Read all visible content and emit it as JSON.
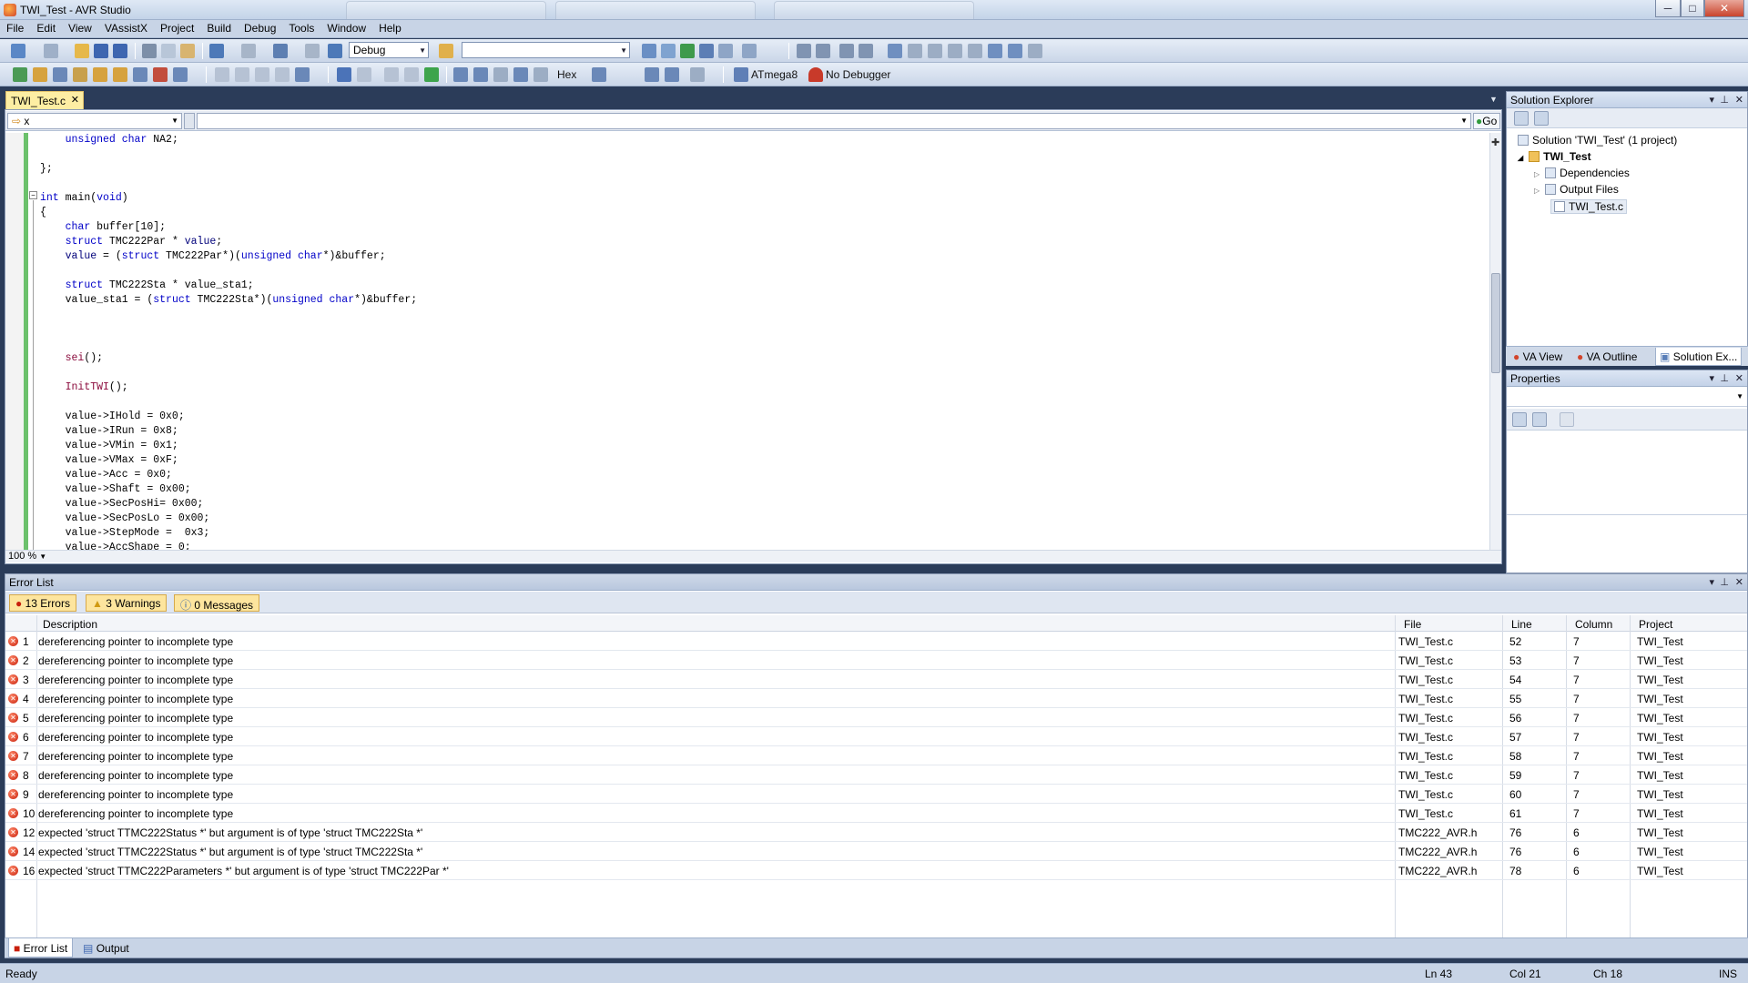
{
  "window": {
    "title": "TWI_Test - AVR Studio",
    "controls": [
      "─",
      "□",
      "✕"
    ]
  },
  "menu": [
    "File",
    "Edit",
    "View",
    "VAssistX",
    "Project",
    "Build",
    "Debug",
    "Tools",
    "Window",
    "Help"
  ],
  "toolbar": {
    "config_combo": "Debug",
    "search_combo": "",
    "hex_label": "Hex",
    "device": "ATmega8",
    "debugger": "No Debugger"
  },
  "editor": {
    "tab_label": "TWI_Test.c",
    "nav_left": "x",
    "go_label": "Go",
    "zoom": "100 %",
    "lines": [
      "    unsigned char NA2;",
      "",
      "};",
      "",
      "int main(void)",
      "{",
      "    char buffer[10];",
      "    struct TMC222Par * value;",
      "    value = (struct TMC222Par*)(unsigned char*)&buffer;",
      "",
      "    struct TMC222Sta * value_sta1;",
      "    value_sta1 = (struct TMC222Sta*)(unsigned char*)&buffer;",
      "",
      "",
      "",
      "    sei();",
      "",
      "    InitTWI();",
      "",
      "    value->IHold = 0x0;",
      "    value->IRun = 0x8;",
      "    value->VMin = 0x1;",
      "    value->VMax = 0xF;",
      "    value->Acc = 0x0;",
      "    value->Shaft = 0x00;",
      "    value->SecPosHi= 0x00;",
      "    value->SecPosLo = 0x00;",
      "    value->StepMode =  0x3;",
      "    value->AccShape = 0;"
    ]
  },
  "solution_explorer": {
    "title": "Solution Explorer",
    "solution": "Solution 'TWI_Test' (1 project)",
    "project": "TWI_Test",
    "dependencies": "Dependencies",
    "output_files": "Output Files",
    "file": "TWI_Test.c",
    "tabs": [
      "VA View",
      "VA Outline",
      "Solution Ex..."
    ]
  },
  "properties": {
    "title": "Properties"
  },
  "error_list": {
    "title": "Error List",
    "filters": {
      "errors": "13 Errors",
      "warnings": "3 Warnings",
      "messages": "0 Messages"
    },
    "columns": [
      "Description",
      "File",
      "Line",
      "Column",
      "Project"
    ],
    "rows": [
      {
        "num": "1",
        "desc": "dereferencing pointer to incomplete type",
        "file": "TWI_Test.c",
        "line": "52",
        "col": "7",
        "project": "TWI_Test"
      },
      {
        "num": "2",
        "desc": "dereferencing pointer to incomplete type",
        "file": "TWI_Test.c",
        "line": "53",
        "col": "7",
        "project": "TWI_Test"
      },
      {
        "num": "3",
        "desc": "dereferencing pointer to incomplete type",
        "file": "TWI_Test.c",
        "line": "54",
        "col": "7",
        "project": "TWI_Test"
      },
      {
        "num": "4",
        "desc": "dereferencing pointer to incomplete type",
        "file": "TWI_Test.c",
        "line": "55",
        "col": "7",
        "project": "TWI_Test"
      },
      {
        "num": "5",
        "desc": "dereferencing pointer to incomplete type",
        "file": "TWI_Test.c",
        "line": "56",
        "col": "7",
        "project": "TWI_Test"
      },
      {
        "num": "6",
        "desc": "dereferencing pointer to incomplete type",
        "file": "TWI_Test.c",
        "line": "57",
        "col": "7",
        "project": "TWI_Test"
      },
      {
        "num": "7",
        "desc": "dereferencing pointer to incomplete type",
        "file": "TWI_Test.c",
        "line": "58",
        "col": "7",
        "project": "TWI_Test"
      },
      {
        "num": "8",
        "desc": "dereferencing pointer to incomplete type",
        "file": "TWI_Test.c",
        "line": "59",
        "col": "7",
        "project": "TWI_Test"
      },
      {
        "num": "9",
        "desc": "dereferencing pointer to incomplete type",
        "file": "TWI_Test.c",
        "line": "60",
        "col": "7",
        "project": "TWI_Test"
      },
      {
        "num": "10",
        "desc": "dereferencing pointer to incomplete type",
        "file": "TWI_Test.c",
        "line": "61",
        "col": "7",
        "project": "TWI_Test"
      },
      {
        "num": "12",
        "desc": "expected 'struct TTMC222Status *' but argument is of type 'struct TMC222Sta *'",
        "file": "TMC222_AVR.h",
        "line": "76",
        "col": "6",
        "project": "TWI_Test"
      },
      {
        "num": "14",
        "desc": "expected 'struct TTMC222Status *' but argument is of type 'struct TMC222Sta *'",
        "file": "TMC222_AVR.h",
        "line": "76",
        "col": "6",
        "project": "TWI_Test"
      },
      {
        "num": "16",
        "desc": "expected 'struct TTMC222Parameters *' but argument is of type 'struct TMC222Par *'",
        "file": "TMC222_AVR.h",
        "line": "78",
        "col": "6",
        "project": "TWI_Test"
      }
    ]
  },
  "bottom_tabs": [
    "Error List",
    "Output"
  ],
  "status": {
    "text": "Ready",
    "ln": "Ln 43",
    "col": "Col 21",
    "ch": "Ch 18",
    "mode": "INS"
  }
}
